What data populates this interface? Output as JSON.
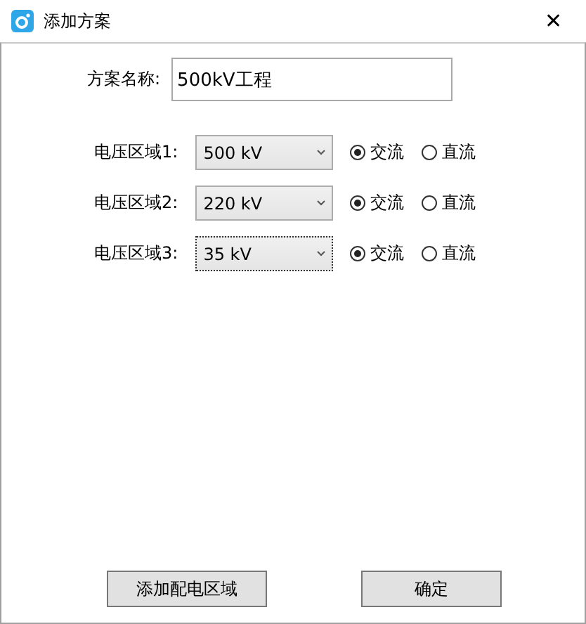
{
  "window": {
    "title": "添加方案",
    "close": "✕"
  },
  "name_field": {
    "label": "方案名称:",
    "value": "500kV工程"
  },
  "regions": [
    {
      "label": "电压区域1:",
      "value": "500 kV",
      "focused": false,
      "options": [
        {
          "label": "交流",
          "selected": true
        },
        {
          "label": "直流",
          "selected": false
        }
      ]
    },
    {
      "label": "电压区域2:",
      "value": "220 kV",
      "focused": false,
      "options": [
        {
          "label": "交流",
          "selected": true
        },
        {
          "label": "直流",
          "selected": false
        }
      ]
    },
    {
      "label": "电压区域3:",
      "value": "35 kV",
      "focused": true,
      "options": [
        {
          "label": "交流",
          "selected": true
        },
        {
          "label": "直流",
          "selected": false
        }
      ]
    }
  ],
  "buttons": [
    "添加配电区域",
    "确定"
  ]
}
